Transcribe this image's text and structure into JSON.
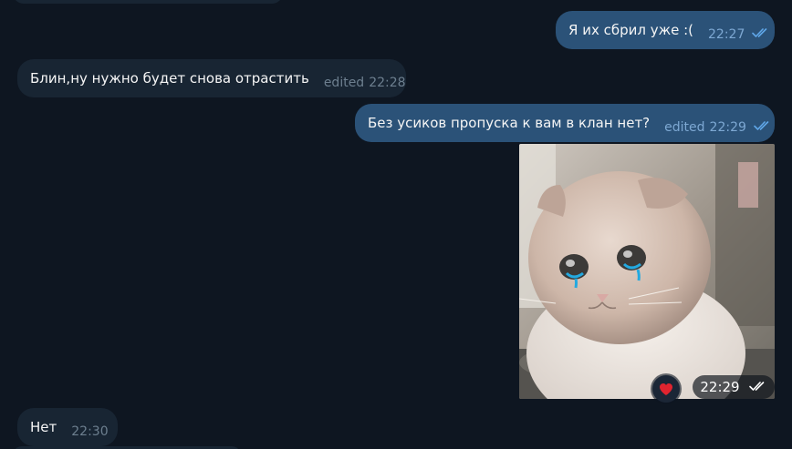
{
  "messages": [
    {
      "direction": "out",
      "text": "Я их сбрил уже :(",
      "time": "22:27",
      "edited": "",
      "status": "read"
    },
    {
      "direction": "in",
      "text": "Блин,ну нужно будет снова отрастить",
      "time": "22:28",
      "edited": "edited"
    },
    {
      "direction": "out",
      "text": "Без усиков пропуска к вам в клан нет?",
      "time": "22:29",
      "edited": "edited",
      "status": "read"
    },
    {
      "direction": "out",
      "type": "photo",
      "photo_description": "crying kitten",
      "time": "22:29",
      "reaction": "❤️",
      "status": "read"
    },
    {
      "direction": "in",
      "text": "Нет",
      "time": "22:30",
      "edited": ""
    }
  ],
  "colors": {
    "background": "#0e1621",
    "incoming_bubble": "#182533",
    "outgoing_bubble": "#2b5278",
    "check_color": "#5fa6e8",
    "meta_in": "#6d7f8f"
  },
  "icons": [
    "double-check-icon",
    "heart-reaction-icon"
  ]
}
